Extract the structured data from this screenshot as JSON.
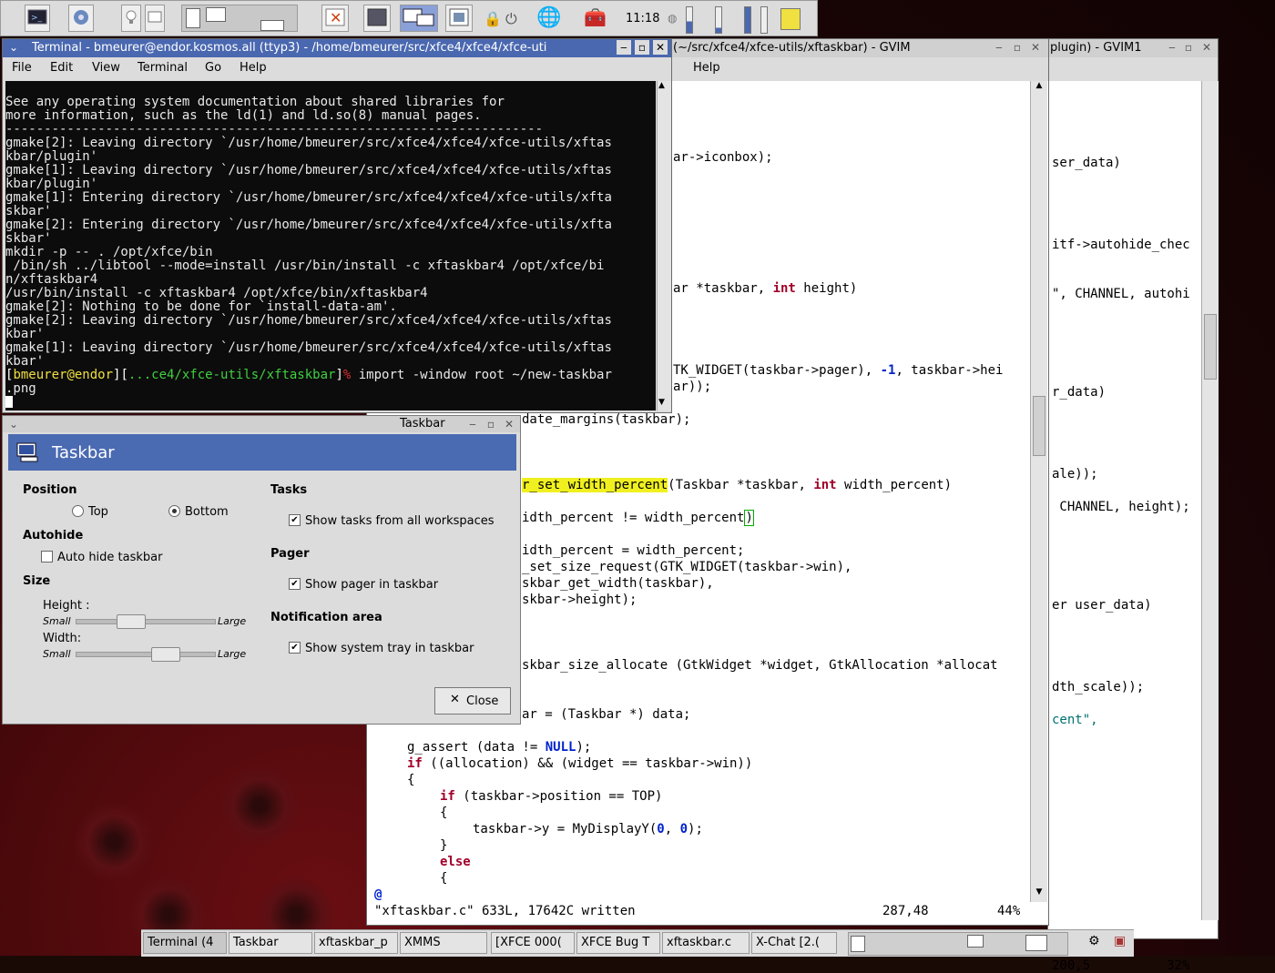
{
  "panel": {
    "clock": "11:18"
  },
  "terminal": {
    "title": "Terminal - bmeurer@endor.kosmos.all (ttyp3) - /home/bmeurer/src/xfce4/xfce4/xfce-uti",
    "menu": [
      "File",
      "Edit",
      "View",
      "Terminal",
      "Go",
      "Help"
    ],
    "lines": [
      "See any operating system documentation about shared libraries for",
      "more information, such as the ld(1) and ld.so(8) manual pages.",
      "----------------------------------------------------------------------",
      "gmake[2]: Leaving directory `/usr/home/bmeurer/src/xfce4/xfce4/xfce-utils/xftas",
      "kbar/plugin'",
      "gmake[1]: Leaving directory `/usr/home/bmeurer/src/xfce4/xfce4/xfce-utils/xftas",
      "kbar/plugin'",
      "gmake[1]: Entering directory `/usr/home/bmeurer/src/xfce4/xfce4/xfce-utils/xfta",
      "skbar'",
      "gmake[2]: Entering directory `/usr/home/bmeurer/src/xfce4/xfce4/xfce-utils/xfta",
      "skbar'",
      "mkdir -p -- . /opt/xfce/bin",
      " /bin/sh ../libtool --mode=install /usr/bin/install -c xftaskbar4 /opt/xfce/bi",
      "n/xftaskbar4",
      "/usr/bin/install -c xftaskbar4 /opt/xfce/bin/xftaskbar4",
      "gmake[2]: Nothing to be done for `install-data-am'.",
      "gmake[2]: Leaving directory `/usr/home/bmeurer/src/xfce4/xfce4/xfce-utils/xftas",
      "kbar'",
      "gmake[1]: Leaving directory `/usr/home/bmeurer/src/xfce4/xfce4/xfce-utils/xftas",
      "kbar'"
    ],
    "prompt_user": "bmeurer@endor",
    "prompt_dir": "...ce4/xfce-utils/xftaskbar",
    "prompt_cmd": " import -window root ~/new-taskbar",
    "prompt_cont": ".png"
  },
  "gvim1": {
    "title": "(~/src/xfce4/xfce-utils/xftaskbar) - GVIM",
    "menu_help": "Help",
    "status_file": "\"xftaskbar.c\" 633L, 17642C written",
    "status_pos": "287,48",
    "status_pct": "44%"
  },
  "gvim2": {
    "title": "plugin) - GVIM1",
    "frag": [
      "ser_data)",
      "itf->autohide_chec",
      "\", CHANNEL, autohi",
      "r_data)",
      "ale));",
      " CHANNEL, height);",
      "er user_data)",
      "dth_scale));",
      "cent\","
    ],
    "status_pos": "200,5",
    "status_pct": "32%"
  },
  "dialog": {
    "title": "Taskbar",
    "banner": "Taskbar",
    "position": "Position",
    "top": "Top",
    "bottom": "Bottom",
    "autohide": "Autohide",
    "auto_hide": "Auto hide taskbar",
    "size": "Size",
    "height": "Height :",
    "width": "Width:",
    "small": "Small",
    "large": "Large",
    "tasks": "Tasks",
    "show_tasks": "Show tasks from all workspaces",
    "pager": "Pager",
    "show_pager": "Show pager in taskbar",
    "notif": "Notification area",
    "show_tray": "Show system tray in taskbar",
    "close": "Close",
    "height_level": 0.36,
    "width_level": 0.67
  },
  "tasks": [
    "Terminal (4",
    "Taskbar",
    "xftaskbar_p",
    "XMMS",
    "[XFCE 000(",
    "XFCE Bug T",
    "xftaskbar.c",
    "X-Chat [2.("
  ]
}
